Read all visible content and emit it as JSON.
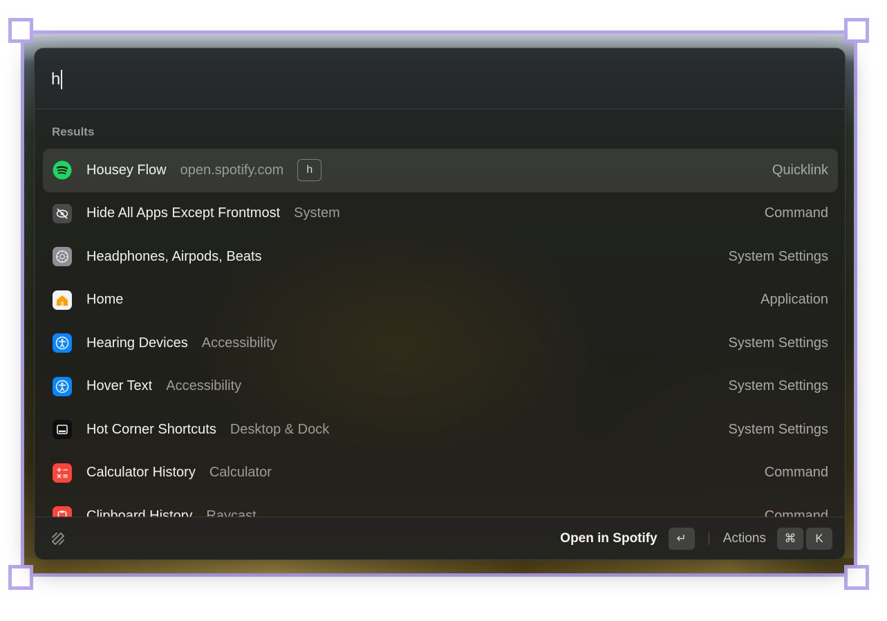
{
  "search": {
    "value": "h",
    "placeholder": ""
  },
  "results": {
    "section_title": "Results",
    "items": [
      {
        "title": "Housey Flow",
        "subtitle": "open.spotify.com",
        "alias": "h",
        "type": "Quicklink",
        "icon": "spotify-icon",
        "icon_color": "#1ed760"
      },
      {
        "title": "Hide All Apps Except Frontmost",
        "subtitle": "System",
        "type": "Command",
        "icon": "eye-slash-icon",
        "icon_color": "#4a4a4a"
      },
      {
        "title": "Headphones, Airpods, Beats",
        "subtitle": "",
        "type": "System Settings",
        "icon": "settings-gear-icon",
        "icon_color": "#8e8e93"
      },
      {
        "title": "Home",
        "subtitle": "",
        "type": "Application",
        "icon": "home-app-icon",
        "icon_color": "#ff9f0a"
      },
      {
        "title": "Hearing Devices",
        "subtitle": "Accessibility",
        "type": "System Settings",
        "icon": "accessibility-icon",
        "icon_color": "#0a84ff"
      },
      {
        "title": "Hover Text",
        "subtitle": "Accessibility",
        "type": "System Settings",
        "icon": "accessibility-icon",
        "icon_color": "#0a84ff"
      },
      {
        "title": "Hot Corner Shortcuts",
        "subtitle": "Desktop & Dock",
        "type": "System Settings",
        "icon": "dock-icon",
        "icon_color": "#1c1c1e"
      },
      {
        "title": "Calculator History",
        "subtitle": "Calculator",
        "type": "Command",
        "icon": "calculator-icon",
        "icon_color": "#ff453a"
      },
      {
        "title": "Clipboard History",
        "subtitle": "Raycast",
        "type": "Command",
        "icon": "clipboard-icon",
        "icon_color": "#ff453a"
      }
    ]
  },
  "footer": {
    "logo_icon": "raycast-logo-icon",
    "primary_action": "Open in Spotify",
    "primary_key": "↵",
    "actions_label": "Actions",
    "actions_keys": [
      "⌘",
      "K"
    ]
  },
  "colors": {
    "frame": "#b8a7f2",
    "panel_bg": "#1e1e1c",
    "selection": "#3a3a38"
  }
}
